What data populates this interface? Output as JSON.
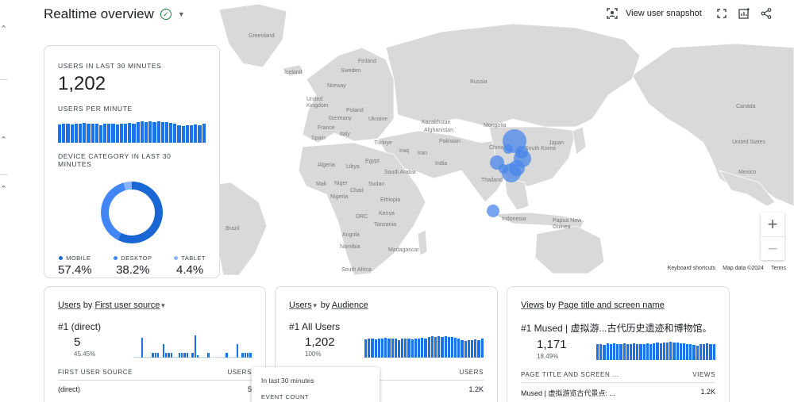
{
  "header": {
    "title": "Realtime overview"
  },
  "toolbar": {
    "snapshot_label": "View user snapshot"
  },
  "map": {
    "labels": [
      {
        "text": "Greenland",
        "id": "greenland"
      },
      {
        "text": "Iceland",
        "id": "iceland"
      },
      {
        "text": "Finland",
        "id": "finland"
      },
      {
        "text": "Sweden",
        "id": "sweden"
      },
      {
        "text": "Norway",
        "id": "norway"
      },
      {
        "text": "United Kingdom",
        "id": "uk"
      },
      {
        "text": "Poland",
        "id": "poland"
      },
      {
        "text": "Germany",
        "id": "germany"
      },
      {
        "text": "Ukraine",
        "id": "ukraine"
      },
      {
        "text": "France",
        "id": "france"
      },
      {
        "text": "Spain",
        "id": "spain"
      },
      {
        "text": "Italy",
        "id": "italy"
      },
      {
        "text": "Russia",
        "id": "russia"
      },
      {
        "text": "Kazakhstan",
        "id": "kazakhstan"
      },
      {
        "text": "Mongolia",
        "id": "mongolia"
      },
      {
        "text": "Türkiye",
        "id": "turkiye"
      },
      {
        "text": "Iraq",
        "id": "iraq"
      },
      {
        "text": "Iran",
        "id": "iran"
      },
      {
        "text": "Afghanistan",
        "id": "afghanistan"
      },
      {
        "text": "Pakistan",
        "id": "pakistan"
      },
      {
        "text": "India",
        "id": "india"
      },
      {
        "text": "China",
        "id": "china"
      },
      {
        "text": "South Korea",
        "id": "southkorea"
      },
      {
        "text": "Japan",
        "id": "japan"
      },
      {
        "text": "Thailand",
        "id": "thailand"
      },
      {
        "text": "Indonesia",
        "id": "indonesia"
      },
      {
        "text": "Papua New Guinea",
        "id": "png"
      },
      {
        "text": "Algeria",
        "id": "algeria"
      },
      {
        "text": "Libya",
        "id": "libya"
      },
      {
        "text": "Egypt",
        "id": "egypt"
      },
      {
        "text": "Saudi Arabia",
        "id": "saudi"
      },
      {
        "text": "Mali",
        "id": "mali"
      },
      {
        "text": "Niger",
        "id": "niger"
      },
      {
        "text": "Chad",
        "id": "chad"
      },
      {
        "text": "Sudan",
        "id": "sudan"
      },
      {
        "text": "Ethiopia",
        "id": "ethiopia"
      },
      {
        "text": "Nigeria",
        "id": "nigeria"
      },
      {
        "text": "DRC",
        "id": "drc"
      },
      {
        "text": "Kenya",
        "id": "kenya"
      },
      {
        "text": "Tanzania",
        "id": "tanzania"
      },
      {
        "text": "Angola",
        "id": "angola"
      },
      {
        "text": "Namibia",
        "id": "namibia"
      },
      {
        "text": "Madagascar",
        "id": "madagascar"
      },
      {
        "text": "South Africa",
        "id": "southafrica"
      },
      {
        "text": "Brazil",
        "id": "brazil"
      },
      {
        "text": "Canada",
        "id": "canada"
      },
      {
        "text": "United States",
        "id": "usa"
      },
      {
        "text": "Mexico",
        "id": "mexico"
      }
    ],
    "attribution": {
      "shortcuts": "Keyboard shortcuts",
      "data": "Map data ©2024",
      "terms": "Terms"
    },
    "zoom_in": "+",
    "zoom_out": "−"
  },
  "users_card": {
    "users_caption": "USERS IN LAST 30 MINUTES",
    "users_value": "1,202",
    "per_minute_caption": "USERS PER MINUTE",
    "per_minute_bars": [
      0.82,
      0.86,
      0.84,
      0.83,
      0.86,
      0.85,
      0.88,
      0.86,
      0.84,
      0.85,
      0.8,
      0.86,
      0.84,
      0.85,
      0.83,
      0.86,
      0.84,
      0.88,
      0.85,
      0.92,
      0.96,
      0.94,
      0.97,
      0.93,
      0.98,
      0.94,
      0.92,
      0.9,
      0.86,
      0.8,
      0.76,
      0.78,
      0.8,
      0.82,
      0.8,
      0.84
    ],
    "device_caption": "DEVICE CATEGORY IN LAST 30 MINUTES",
    "devices": [
      {
        "name": "MOBILE",
        "value": "57.4%",
        "color": "#1967d2"
      },
      {
        "name": "DESKTOP",
        "value": "38.2%",
        "color": "#4285f4"
      },
      {
        "name": "TABLET",
        "value": "4.4%",
        "color": "#8ab4f8"
      }
    ]
  },
  "cards": [
    {
      "title_metric": "Users",
      "title_dim": "First user source",
      "rank": "#1  (direct)",
      "value": "5",
      "pct": "45.45%",
      "bars": [
        0,
        0,
        0,
        0.9,
        0,
        0,
        0,
        0.2,
        0.2,
        0.2,
        0,
        0.6,
        0.2,
        0.2,
        0.2,
        0,
        0,
        0.2,
        0.2,
        0.2,
        0.2,
        0,
        0.2,
        1.0,
        0.1,
        0,
        0,
        0,
        0.2,
        0,
        0,
        0,
        0,
        0,
        0,
        0.2,
        0,
        0,
        0,
        0.6,
        0,
        0.2,
        0.2,
        0.2,
        0.2
      ],
      "col_left": "FIRST USER SOURCE",
      "col_right": "USERS",
      "row_left": "(direct)",
      "row_right": "5"
    },
    {
      "title_metric": "Users",
      "title_dim": "Audience",
      "rank": "#1  All Users",
      "value": "1,202",
      "pct": "100%",
      "bars": [
        0.82,
        0.86,
        0.84,
        0.83,
        0.86,
        0.85,
        0.88,
        0.86,
        0.84,
        0.85,
        0.8,
        0.86,
        0.84,
        0.85,
        0.83,
        0.86,
        0.84,
        0.88,
        0.85,
        0.92,
        0.96,
        0.94,
        0.97,
        0.93,
        0.98,
        0.94,
        0.92,
        0.9,
        0.86,
        0.8,
        0.76,
        0.78,
        0.8,
        0.82,
        0.8,
        0.84
      ],
      "col_left": "",
      "col_right": "USERS",
      "row_left": "",
      "row_right": "1.2K"
    },
    {
      "title_metric": "Views",
      "title_dim": "Page title and screen name",
      "rank": "#1  Mused | 虚拟游...古代历史遗迹和博物馆。",
      "value": "1,171",
      "pct": "18.49%",
      "bars": [
        0.7,
        0.72,
        0.68,
        0.74,
        0.7,
        0.76,
        0.72,
        0.7,
        0.75,
        0.72,
        0.7,
        0.74,
        0.73,
        0.7,
        0.72,
        0.76,
        0.71,
        0.74,
        0.78,
        0.76,
        0.8,
        0.78,
        0.82,
        0.79,
        0.8,
        0.76,
        0.74,
        0.72,
        0.7,
        0.68,
        0.66,
        0.7,
        0.72,
        0.74,
        0.7,
        0.72
      ],
      "col_left": "PAGE TITLE AND SCREEN ...",
      "col_right": "VIEWS",
      "row_left": "Mused | 虚拟游览古代景点: ...",
      "row_right": "1.2K"
    }
  ],
  "tooltip": {
    "line1": "In last 30 minutes",
    "line2": "EVENT COUNT"
  }
}
